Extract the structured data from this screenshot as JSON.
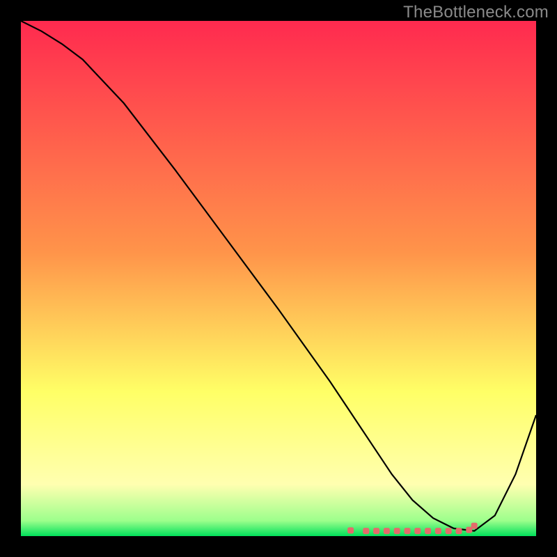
{
  "watermark": "TheBottleneck.com",
  "chart_data": {
    "type": "line",
    "title": "",
    "xlabel": "",
    "ylabel": "",
    "xlim": [
      0,
      100
    ],
    "ylim": [
      0,
      100
    ],
    "legend": false,
    "grid": false,
    "background_gradient": {
      "stops": [
        {
          "pct": 0,
          "color": "#ff2a4f"
        },
        {
          "pct": 45,
          "color": "#ff944a"
        },
        {
          "pct": 72,
          "color": "#ffff66"
        },
        {
          "pct": 90,
          "color": "#ffffb0"
        },
        {
          "pct": 97,
          "color": "#9dff8c"
        },
        {
          "pct": 100,
          "color": "#00e05a"
        }
      ]
    },
    "series": [
      {
        "name": "bottleneck-curve",
        "color": "#000000",
        "width": 2.2,
        "x": [
          0,
          4,
          8,
          12,
          20,
          30,
          40,
          50,
          60,
          64,
          68,
          72,
          76,
          80,
          84,
          88,
          92,
          96,
          100
        ],
        "y": [
          100,
          98,
          95.5,
          92.5,
          84,
          71,
          57.5,
          44,
          30,
          24,
          18,
          12,
          7,
          3.5,
          1.5,
          1,
          4,
          12,
          23.5
        ]
      },
      {
        "name": "optimal-band-markers",
        "color": "#e36b6b",
        "marker_size": 9,
        "type": "scatter",
        "x": [
          64,
          67,
          69,
          71,
          73,
          75,
          77,
          79,
          81,
          83,
          85,
          87,
          88
        ],
        "y": [
          1.1,
          1.0,
          1.0,
          1.0,
          1.0,
          1.0,
          1.0,
          1.0,
          1.0,
          1.0,
          1.0,
          1.2,
          2.0
        ]
      }
    ]
  }
}
